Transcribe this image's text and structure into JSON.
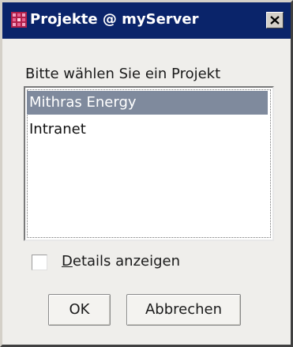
{
  "window": {
    "title": "Projekte @ myServer",
    "title_icon": "red-grid-app-icon",
    "close_icon": "close-x-icon"
  },
  "dialog": {
    "prompt": "Bitte wählen Sie ein Projekt",
    "projects": [
      {
        "label": "Mithras Energy",
        "selected": true
      },
      {
        "label": "Intranet",
        "selected": false
      }
    ],
    "details_checkbox": {
      "mnemonic": "D",
      "label_rest": "etails anzeigen",
      "checked": false
    },
    "ok_label": "OK",
    "cancel_label": "Abbrechen"
  },
  "colors": {
    "titlebar": "#0a246a",
    "selection": "#7f8a9d",
    "dialog_bg": "#efeeeb"
  }
}
